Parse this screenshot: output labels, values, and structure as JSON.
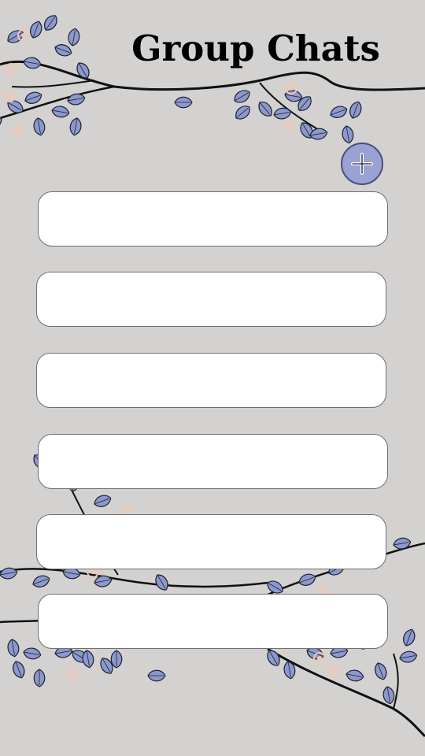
{
  "header": {
    "title": "Group Chats"
  },
  "actions": {
    "add_icon": "plus-icon",
    "accent_color": "#9aa1d3"
  },
  "chats": [
    {
      "name": ""
    },
    {
      "name": ""
    },
    {
      "name": ""
    },
    {
      "name": ""
    },
    {
      "name": ""
    },
    {
      "name": ""
    }
  ],
  "theme": {
    "background": "#d3d2d1",
    "leaf_color": "#8d98cc",
    "blossom_color": "#f0c7b4",
    "row_color": "#ffffff"
  }
}
